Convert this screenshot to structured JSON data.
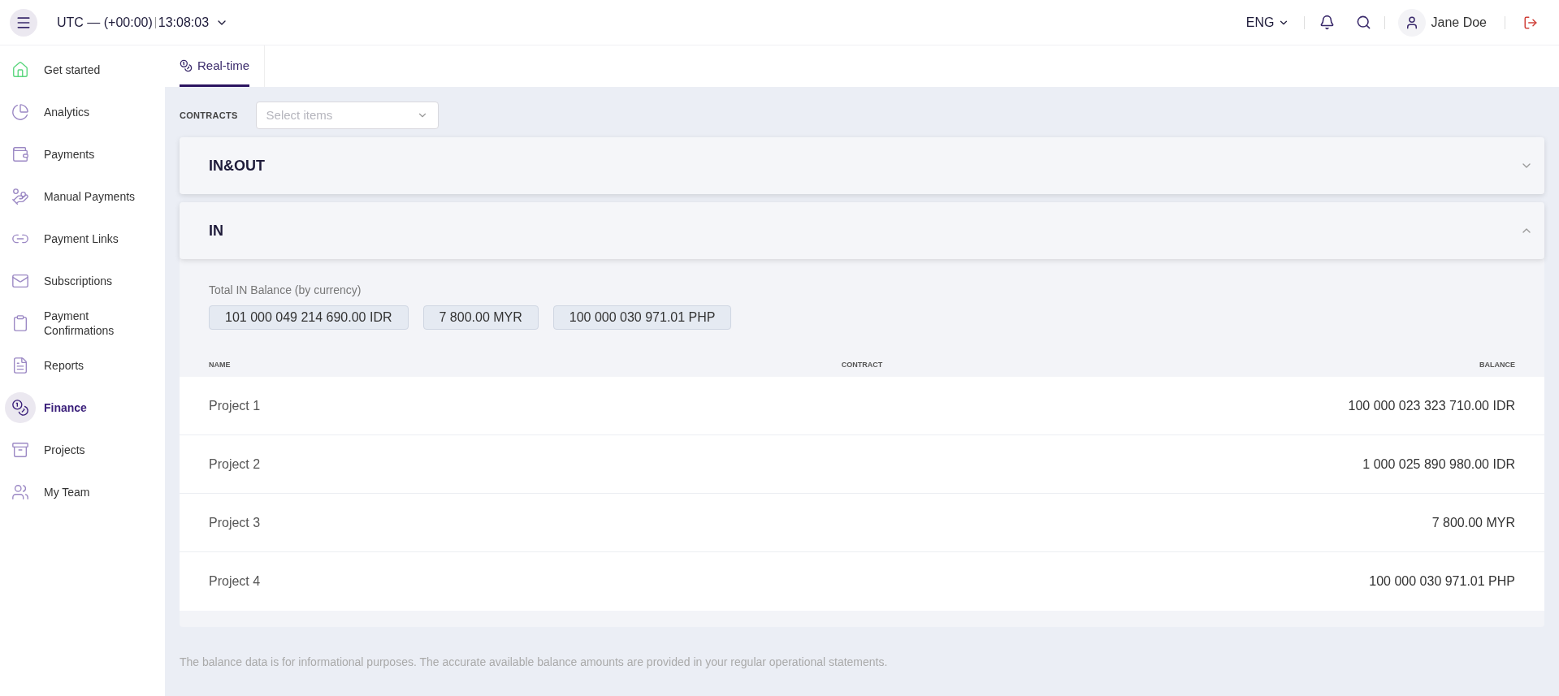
{
  "header": {
    "timezone": "UTC — (+00:00)",
    "time": "13:08:03",
    "language": "ENG",
    "user": "Jane Doe"
  },
  "sidebar": {
    "items": [
      {
        "label": "Get started",
        "selected": false
      },
      {
        "label": "Analytics",
        "selected": false
      },
      {
        "label": "Payments",
        "selected": false
      },
      {
        "label": "Manual Payments",
        "selected": false
      },
      {
        "label": "Payment Links",
        "selected": false
      },
      {
        "label": "Subscriptions",
        "selected": false
      },
      {
        "label": "Payment Confirmations",
        "selected": false
      },
      {
        "label": "Reports",
        "selected": false
      },
      {
        "label": "Finance",
        "selected": true
      },
      {
        "label": "Projects",
        "selected": false
      },
      {
        "label": "My Team",
        "selected": false
      }
    ]
  },
  "tabs": [
    {
      "label": "Real-time",
      "selected": true
    }
  ],
  "filter": {
    "label": "CONTRACTS",
    "placeholder": "Select items"
  },
  "sections": [
    {
      "title": "IN&OUT",
      "expanded": false
    },
    {
      "title": "IN",
      "expanded": true,
      "total_label": "Total IN Balance (by currency)",
      "totals": [
        "101 000 049 214 690.00 IDR",
        "7 800.00 MYR",
        "100 000 030 971.01 PHP"
      ],
      "table": {
        "columns": [
          "NAME",
          "CONTRACT",
          "BALANCE"
        ],
        "rows": [
          {
            "name": "Project 1",
            "balance": "100 000 023 323 710.00 IDR"
          },
          {
            "name": "Project 2",
            "balance": "1 000 025 890 980.00 IDR"
          },
          {
            "name": "Project 3",
            "balance": "7 800.00 MYR"
          },
          {
            "name": "Project 4",
            "balance": "100 000 030 971.01 PHP"
          }
        ]
      }
    }
  ],
  "footnote": "The balance data is for informational purposes. The accurate available balance amounts are provided in your regular operational statements."
}
